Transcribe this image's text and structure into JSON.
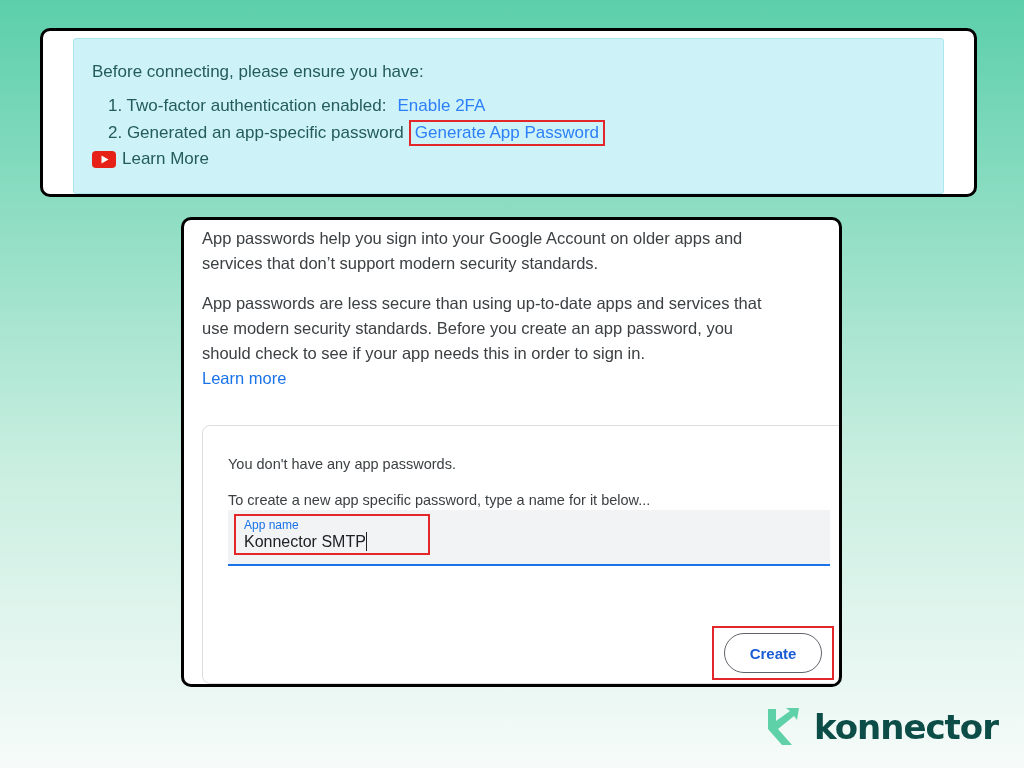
{
  "checklist": {
    "heading": "Before connecting, please ensure you have:",
    "items": [
      {
        "text": "1. Two-factor authentication enabled:",
        "link": "Enable 2FA",
        "highlighted": false
      },
      {
        "text": "2. Generated an app-specific password",
        "link": "Generate App Password",
        "highlighted": true
      }
    ],
    "video_link": "Learn More"
  },
  "app_passwords": {
    "paragraphs": [
      "App passwords help you sign into your Google Account on older apps and services that don’t support modern security standards.",
      "App passwords are less secure than using up-to-date apps and services that use modern security standards. Before you create an app password, you should check to see if your app needs this in order to sign in."
    ],
    "learn_more": "Learn more",
    "card": {
      "empty_message": "You don't have any app passwords.",
      "instruction": "To create a new app specific password, type a name for it below...",
      "field": {
        "label": "App name",
        "value": "Konnector SMTP",
        "highlighted": true
      },
      "create_button": {
        "label": "Create",
        "highlighted": true
      }
    }
  },
  "brand": {
    "name": "konnector"
  }
}
